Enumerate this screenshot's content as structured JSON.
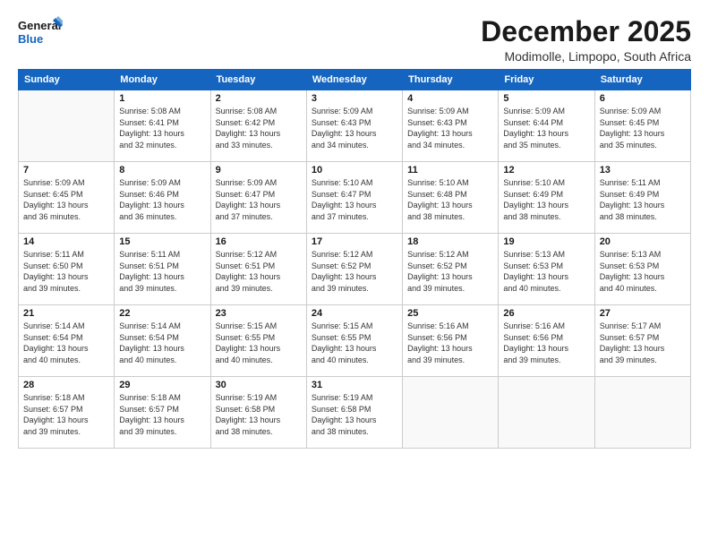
{
  "logo": {
    "line1": "General",
    "line2": "Blue"
  },
  "title": "December 2025",
  "location": "Modimolle, Limpopo, South Africa",
  "days_header": [
    "Sunday",
    "Monday",
    "Tuesday",
    "Wednesday",
    "Thursday",
    "Friday",
    "Saturday"
  ],
  "weeks": [
    [
      {
        "num": "",
        "info": []
      },
      {
        "num": "1",
        "info": [
          "Sunrise: 5:08 AM",
          "Sunset: 6:41 PM",
          "Daylight: 13 hours",
          "and 32 minutes."
        ]
      },
      {
        "num": "2",
        "info": [
          "Sunrise: 5:08 AM",
          "Sunset: 6:42 PM",
          "Daylight: 13 hours",
          "and 33 minutes."
        ]
      },
      {
        "num": "3",
        "info": [
          "Sunrise: 5:09 AM",
          "Sunset: 6:43 PM",
          "Daylight: 13 hours",
          "and 34 minutes."
        ]
      },
      {
        "num": "4",
        "info": [
          "Sunrise: 5:09 AM",
          "Sunset: 6:43 PM",
          "Daylight: 13 hours",
          "and 34 minutes."
        ]
      },
      {
        "num": "5",
        "info": [
          "Sunrise: 5:09 AM",
          "Sunset: 6:44 PM",
          "Daylight: 13 hours",
          "and 35 minutes."
        ]
      },
      {
        "num": "6",
        "info": [
          "Sunrise: 5:09 AM",
          "Sunset: 6:45 PM",
          "Daylight: 13 hours",
          "and 35 minutes."
        ]
      }
    ],
    [
      {
        "num": "7",
        "info": [
          "Sunrise: 5:09 AM",
          "Sunset: 6:45 PM",
          "Daylight: 13 hours",
          "and 36 minutes."
        ]
      },
      {
        "num": "8",
        "info": [
          "Sunrise: 5:09 AM",
          "Sunset: 6:46 PM",
          "Daylight: 13 hours",
          "and 36 minutes."
        ]
      },
      {
        "num": "9",
        "info": [
          "Sunrise: 5:09 AM",
          "Sunset: 6:47 PM",
          "Daylight: 13 hours",
          "and 37 minutes."
        ]
      },
      {
        "num": "10",
        "info": [
          "Sunrise: 5:10 AM",
          "Sunset: 6:47 PM",
          "Daylight: 13 hours",
          "and 37 minutes."
        ]
      },
      {
        "num": "11",
        "info": [
          "Sunrise: 5:10 AM",
          "Sunset: 6:48 PM",
          "Daylight: 13 hours",
          "and 38 minutes."
        ]
      },
      {
        "num": "12",
        "info": [
          "Sunrise: 5:10 AM",
          "Sunset: 6:49 PM",
          "Daylight: 13 hours",
          "and 38 minutes."
        ]
      },
      {
        "num": "13",
        "info": [
          "Sunrise: 5:11 AM",
          "Sunset: 6:49 PM",
          "Daylight: 13 hours",
          "and 38 minutes."
        ]
      }
    ],
    [
      {
        "num": "14",
        "info": [
          "Sunrise: 5:11 AM",
          "Sunset: 6:50 PM",
          "Daylight: 13 hours",
          "and 39 minutes."
        ]
      },
      {
        "num": "15",
        "info": [
          "Sunrise: 5:11 AM",
          "Sunset: 6:51 PM",
          "Daylight: 13 hours",
          "and 39 minutes."
        ]
      },
      {
        "num": "16",
        "info": [
          "Sunrise: 5:12 AM",
          "Sunset: 6:51 PM",
          "Daylight: 13 hours",
          "and 39 minutes."
        ]
      },
      {
        "num": "17",
        "info": [
          "Sunrise: 5:12 AM",
          "Sunset: 6:52 PM",
          "Daylight: 13 hours",
          "and 39 minutes."
        ]
      },
      {
        "num": "18",
        "info": [
          "Sunrise: 5:12 AM",
          "Sunset: 6:52 PM",
          "Daylight: 13 hours",
          "and 39 minutes."
        ]
      },
      {
        "num": "19",
        "info": [
          "Sunrise: 5:13 AM",
          "Sunset: 6:53 PM",
          "Daylight: 13 hours",
          "and 40 minutes."
        ]
      },
      {
        "num": "20",
        "info": [
          "Sunrise: 5:13 AM",
          "Sunset: 6:53 PM",
          "Daylight: 13 hours",
          "and 40 minutes."
        ]
      }
    ],
    [
      {
        "num": "21",
        "info": [
          "Sunrise: 5:14 AM",
          "Sunset: 6:54 PM",
          "Daylight: 13 hours",
          "and 40 minutes."
        ]
      },
      {
        "num": "22",
        "info": [
          "Sunrise: 5:14 AM",
          "Sunset: 6:54 PM",
          "Daylight: 13 hours",
          "and 40 minutes."
        ]
      },
      {
        "num": "23",
        "info": [
          "Sunrise: 5:15 AM",
          "Sunset: 6:55 PM",
          "Daylight: 13 hours",
          "and 40 minutes."
        ]
      },
      {
        "num": "24",
        "info": [
          "Sunrise: 5:15 AM",
          "Sunset: 6:55 PM",
          "Daylight: 13 hours",
          "and 40 minutes."
        ]
      },
      {
        "num": "25",
        "info": [
          "Sunrise: 5:16 AM",
          "Sunset: 6:56 PM",
          "Daylight: 13 hours",
          "and 39 minutes."
        ]
      },
      {
        "num": "26",
        "info": [
          "Sunrise: 5:16 AM",
          "Sunset: 6:56 PM",
          "Daylight: 13 hours",
          "and 39 minutes."
        ]
      },
      {
        "num": "27",
        "info": [
          "Sunrise: 5:17 AM",
          "Sunset: 6:57 PM",
          "Daylight: 13 hours",
          "and 39 minutes."
        ]
      }
    ],
    [
      {
        "num": "28",
        "info": [
          "Sunrise: 5:18 AM",
          "Sunset: 6:57 PM",
          "Daylight: 13 hours",
          "and 39 minutes."
        ]
      },
      {
        "num": "29",
        "info": [
          "Sunrise: 5:18 AM",
          "Sunset: 6:57 PM",
          "Daylight: 13 hours",
          "and 39 minutes."
        ]
      },
      {
        "num": "30",
        "info": [
          "Sunrise: 5:19 AM",
          "Sunset: 6:58 PM",
          "Daylight: 13 hours",
          "and 38 minutes."
        ]
      },
      {
        "num": "31",
        "info": [
          "Sunrise: 5:19 AM",
          "Sunset: 6:58 PM",
          "Daylight: 13 hours",
          "and 38 minutes."
        ]
      },
      {
        "num": "",
        "info": []
      },
      {
        "num": "",
        "info": []
      },
      {
        "num": "",
        "info": []
      }
    ]
  ]
}
